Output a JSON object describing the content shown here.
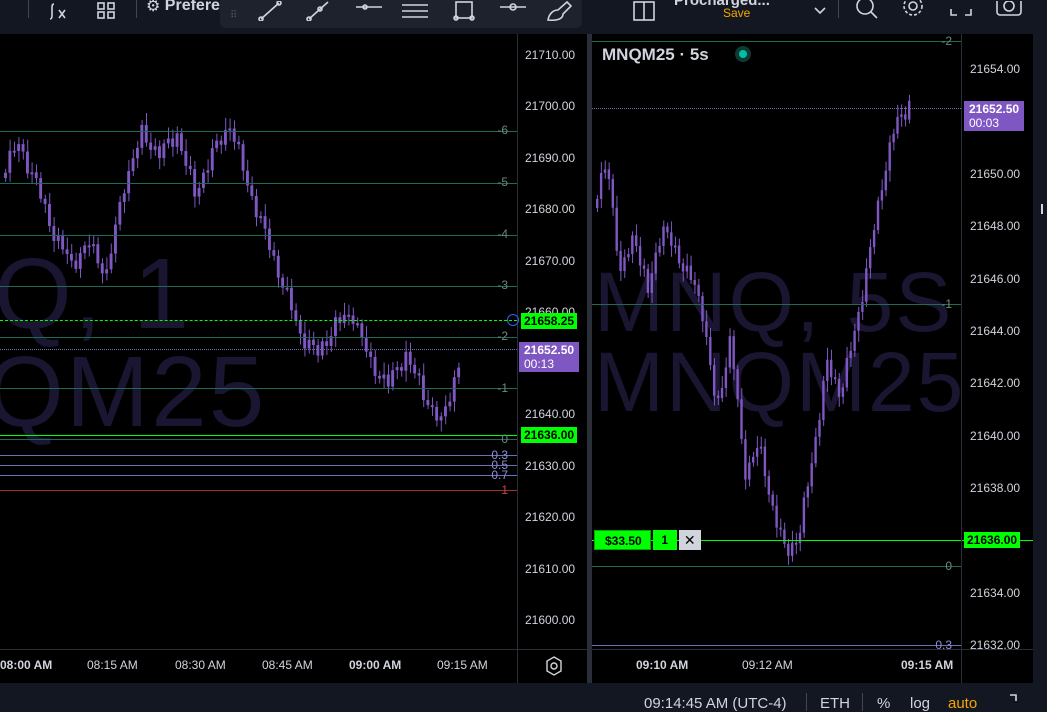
{
  "toolbar": {
    "indicators_icon": "fx-icon",
    "templates_icon": "grid-icon",
    "preferences_label": "Prefere",
    "drawing_tools": [
      "trend-line-icon",
      "ray-icon",
      "horizontal-line-icon",
      "parallel-lines-icon",
      "rectangle-icon",
      "measure-icon",
      "brush-icon"
    ],
    "layout_title": "Procharged...",
    "layout_save": "Save",
    "search_icon": "search-icon",
    "settings_icon": "gear-icon",
    "fullscreen_icon": "fullscreen-icon",
    "snapshot_icon": "camera-icon"
  },
  "left_chart": {
    "watermark_line1": "Q, 1",
    "watermark_line2": "QM25",
    "price_ticks": [
      "21710.00",
      "21700.00",
      "21690.00",
      "21680.00",
      "21670.00",
      "21660.00",
      "21640.00",
      "21630.00",
      "21620.00",
      "21610.00",
      "21600.00"
    ],
    "fib_labels": [
      "-6",
      "-5",
      "-4",
      "-3",
      "-2",
      "-1",
      "0",
      "0.3",
      "0.5",
      "0.7",
      "1"
    ],
    "time_ticks": [
      "08:00 AM",
      "08:15 AM",
      "08:30 AM",
      "08:45 AM",
      "09:00 AM",
      "09:15 AM"
    ],
    "alert_price": "21658.25",
    "last_price": "21652.50",
    "last_countdown": "00:13",
    "position_price": "21636.00",
    "settings_icon": "gear-icon"
  },
  "right_chart": {
    "symbol_title": "MNQM25 · 5s",
    "watermark_line1": "MNQ, 5S",
    "watermark_line2": "MNQM25",
    "price_ticks": [
      "21654.00",
      "21650.00",
      "21648.00",
      "21646.00",
      "21644.00",
      "21642.00",
      "21640.00",
      "21638.00",
      "21634.00",
      "21632.00"
    ],
    "fib_labels": [
      "-2",
      "-1",
      "0",
      "0.3"
    ],
    "time_ticks": [
      "09:10 AM",
      "09:12 AM",
      "09:15 AM"
    ],
    "last_price": "21652.50",
    "last_countdown": "00:03",
    "position_price": "21636.00",
    "order_pnl": "$33.50",
    "order_qty": "1",
    "order_close": "✕"
  },
  "bottom_bar": {
    "clock": "09:14:45 AM (UTC-4)",
    "session": "ETH",
    "percent": "%",
    "log": "log",
    "auto": "auto"
  },
  "colors": {
    "candle": "#7e57c2",
    "fib_line": "#1e6b55",
    "position_green": "#00ff00",
    "fib_one": "#9c2f2f",
    "fib_mid": "#6b6fb5"
  }
}
